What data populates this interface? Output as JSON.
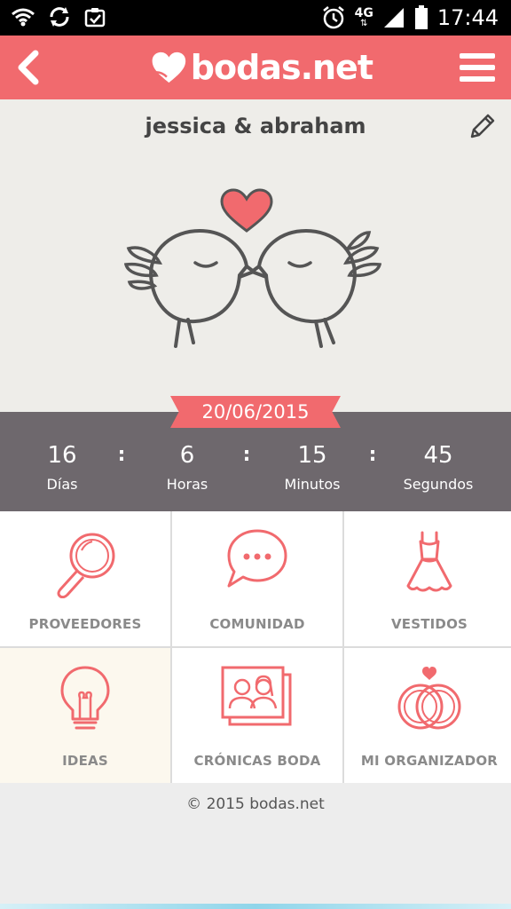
{
  "status_bar": {
    "network": "4G",
    "time": "17:44"
  },
  "brand": {
    "name": "bodas.net",
    "accent": "#f16a6e"
  },
  "couple": {
    "names": "jessica & abraham"
  },
  "wedding": {
    "date": "20/06/2015"
  },
  "countdown": [
    {
      "value": "16",
      "label": "Días"
    },
    {
      "value": "6",
      "label": "Horas"
    },
    {
      "value": "15",
      "label": "Minutos"
    },
    {
      "value": "45",
      "label": "Segundos"
    }
  ],
  "countdown_separator": ":",
  "tiles": [
    {
      "label": "PROVEEDORES",
      "icon": "magnifier-icon"
    },
    {
      "label": "COMUNIDAD",
      "icon": "chat-bubble-icon"
    },
    {
      "label": "VESTIDOS",
      "icon": "dress-icon"
    },
    {
      "label": "IDEAS",
      "icon": "lightbulb-icon"
    },
    {
      "label": "CRÓNICAS BODA",
      "icon": "photos-icon"
    },
    {
      "label": "MI ORGANIZADOR",
      "icon": "rings-icon"
    }
  ],
  "footer": {
    "copyright": "© 2015 bodas.net"
  }
}
